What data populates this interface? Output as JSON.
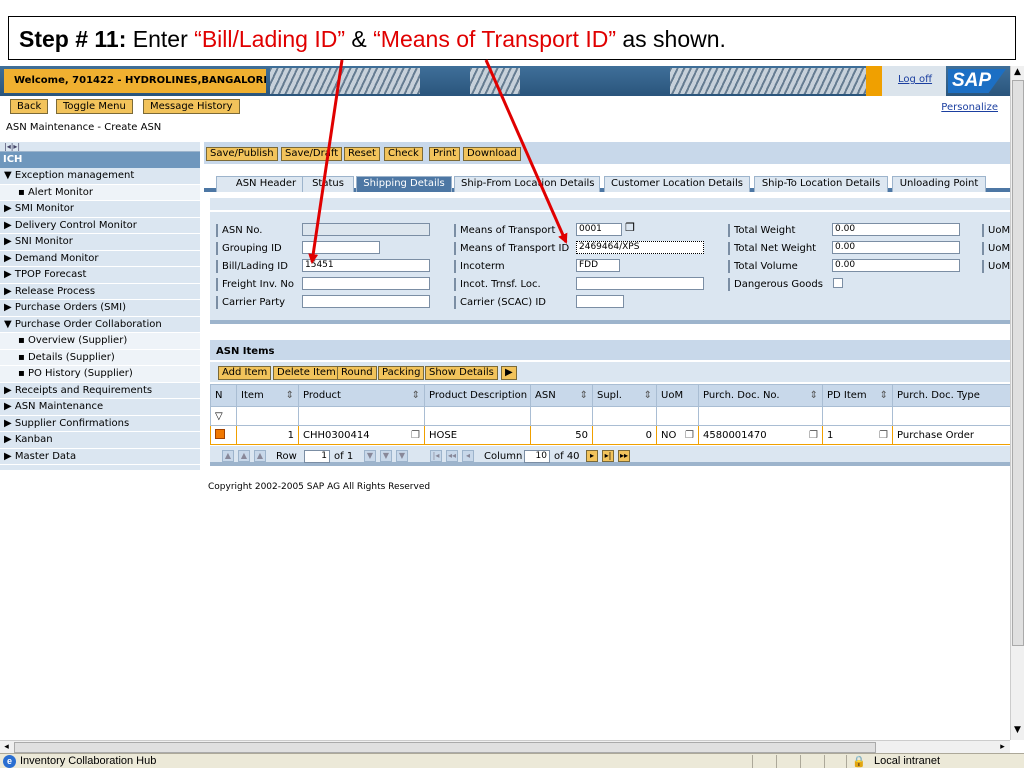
{
  "callout": {
    "step": "Step # 11:",
    "enter": " Enter ",
    "field1": "“Bill/Lading ID”",
    "amp": " & ",
    "field2": "“Means of Transport ID”",
    "tail": " as shown."
  },
  "header": {
    "welcome": "Welcome, 701422 - HYDROLINES,BANGALORE",
    "logoff": "Log off",
    "logo": "SAP",
    "personalize": "Personalize",
    "nav_buttons": [
      "Back",
      "Toggle Menu",
      "Message History"
    ],
    "breadcrumb": "ASN Maintenance - Create ASN"
  },
  "leftnav": {
    "top_icons": "|◂|▸|",
    "title": "ICH",
    "items": [
      {
        "label": "▼ Exception management",
        "sub": false
      },
      {
        "label": "▪ Alert Monitor",
        "sub": true
      },
      {
        "label": "▶ SMI Monitor",
        "sub": false
      },
      {
        "label": "▶ Delivery Control Monitor",
        "sub": false
      },
      {
        "label": "▶ SNI Monitor",
        "sub": false
      },
      {
        "label": "▶ Demand Monitor",
        "sub": false
      },
      {
        "label": "▶ TPOP Forecast",
        "sub": false
      },
      {
        "label": "▶ Release Process",
        "sub": false
      },
      {
        "label": "▶ Purchase Orders (SMI)",
        "sub": false
      },
      {
        "label": "▼ Purchase Order Collaboration",
        "sub": false
      },
      {
        "label": "▪ Overview (Supplier)",
        "sub": true
      },
      {
        "label": "▪ Details (Supplier)",
        "sub": true
      },
      {
        "label": "▪ PO History (Supplier)",
        "sub": true
      },
      {
        "label": "▶ Receipts and Requirements",
        "sub": false
      },
      {
        "label": "▶ ASN Maintenance",
        "sub": false
      },
      {
        "label": "▶ Supplier Confirmations",
        "sub": false
      },
      {
        "label": "▶ Kanban",
        "sub": false
      },
      {
        "label": "▶ Master Data",
        "sub": false
      }
    ]
  },
  "toolbar": {
    "buttons": [
      "Save/Publish",
      "Save/Draft",
      "Reset",
      "Check",
      "Print",
      "Download"
    ]
  },
  "tabs": {
    "items": [
      "ASN Header",
      "Status",
      "Shipping Details",
      "Ship-From Location Details",
      "Customer Location Details",
      "Ship-To Location Details",
      "Unloading Point"
    ],
    "active": "Shipping Details"
  },
  "form": {
    "asn_no": {
      "label": "ASN No.",
      "value": ""
    },
    "grouping_id": {
      "label": "Grouping ID",
      "value": ""
    },
    "bill_lading_id": {
      "label": "Bill/Lading ID",
      "value": "15451"
    },
    "freight_inv_no": {
      "label": "Freight Inv. No",
      "value": ""
    },
    "carrier_party": {
      "label": "Carrier Party",
      "value": ""
    },
    "means_of_transport": {
      "label": "Means of Transport",
      "value": "0001"
    },
    "means_of_transport_id": {
      "label": "Means of Transport ID",
      "value": "2469464/XPS"
    },
    "incoterm": {
      "label": "Incoterm",
      "value": "FDD"
    },
    "incot_trnsf_loc": {
      "label": "Incot. Trnsf. Loc.",
      "value": ""
    },
    "carrier_scac_id": {
      "label": "Carrier (SCAC) ID",
      "value": ""
    },
    "total_weight": {
      "label": "Total Weight",
      "value": "0.00"
    },
    "total_net_weight": {
      "label": "Total Net Weight",
      "value": "0.00"
    },
    "total_volume": {
      "label": "Total Volume",
      "value": "0.00"
    },
    "dangerous_goods": {
      "label": "Dangerous Goods",
      "checked": false
    },
    "uom_label": "UoM"
  },
  "asn_items": {
    "title": "ASN Items",
    "buttons": [
      "Add Item",
      "Delete Item",
      "Round",
      "Packing",
      "Show Details"
    ],
    "more_icon": "▶",
    "columns": [
      "N",
      "Item",
      "Product",
      "Product Description",
      "ASN",
      "Supl.",
      "UoM",
      "Purch. Doc. No.",
      "PD Item",
      "Purch. Doc. Type"
    ],
    "filter_icon": "▽",
    "rows": [
      {
        "item": "1",
        "product": "CHH0300414",
        "description": "HOSE",
        "asn": "50",
        "supl": "0",
        "uom": "NO",
        "purch_doc_no": "4580001470",
        "pd_item": "1",
        "purch_doc_type": "Purchase Order"
      }
    ],
    "pager": {
      "row_label": "Row",
      "row_value": "1",
      "row_of": "of 1",
      "column_label": "Column",
      "column_value": "10",
      "column_of": "of 40"
    }
  },
  "copyright": "Copyright 2002-2005 SAP AG All Rights Reserved",
  "statusbar": {
    "text": "Inventory Collaboration Hub",
    "zone": "Local intranet"
  },
  "colors": {
    "arrow": "#e00000",
    "accent_orange": "#f0a000",
    "sap_blue": "#4d77a4"
  }
}
